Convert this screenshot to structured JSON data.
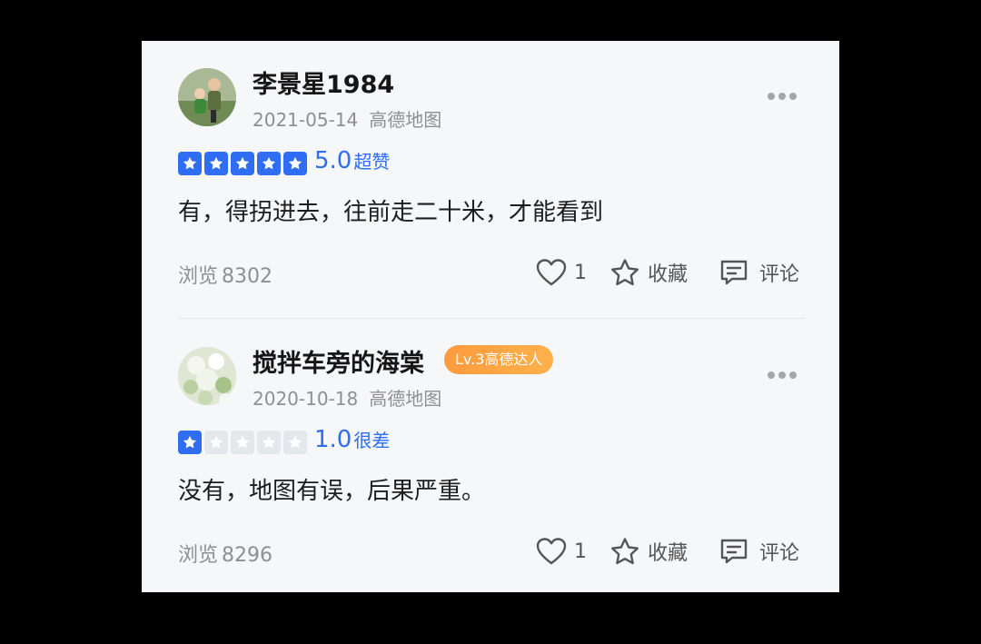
{
  "reviews": [
    {
      "username": "李景星1984",
      "level_badge": "",
      "date": "2021-05-14",
      "source": "高德地图",
      "rating": 5,
      "score": "5.0",
      "score_label": "超赞",
      "comment": "有，得拐进去，往前走二十米，才能看到",
      "views_label": "浏览",
      "views": "8302",
      "likes": "1",
      "favorite_label": "收藏",
      "comment_label": "评论"
    },
    {
      "username": "搅拌车旁的海棠",
      "level_badge": "Lv.3高德达人",
      "date": "2020-10-18",
      "source": "高德地图",
      "rating": 1,
      "score": "1.0",
      "score_label": "很差",
      "comment": "没有，地图有误，后果严重。",
      "views_label": "浏览",
      "views": "8296",
      "likes": "1",
      "favorite_label": "收藏",
      "comment_label": "评论"
    }
  ],
  "colors": {
    "accent": "#2f6df2",
    "badge": "#ff9a3d",
    "muted": "#8e8e93",
    "star_off": "#e4e7ec"
  },
  "icons": [
    "more-icon",
    "star-icon",
    "heart-icon",
    "favorite-star-icon",
    "comment-icon"
  ]
}
